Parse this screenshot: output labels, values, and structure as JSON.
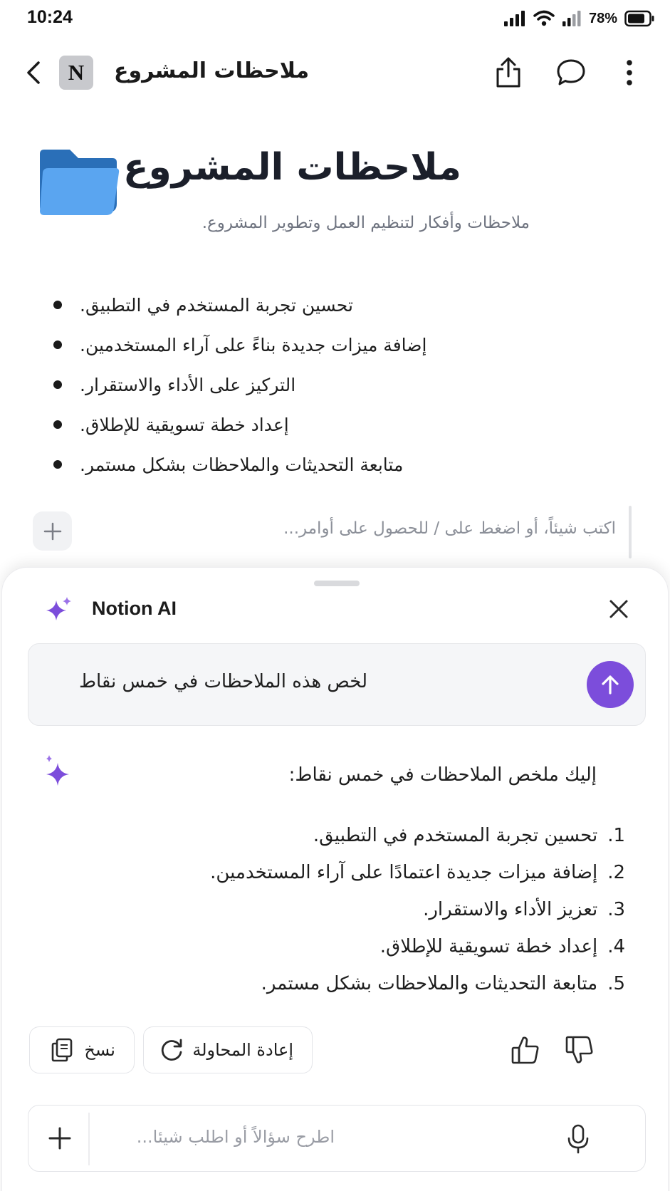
{
  "status_bar": {
    "time": "10:24",
    "battery": "78%",
    "icons": [
      "signal-icon",
      "wifi-icon",
      "secondary-signal-icon",
      "battery-icon"
    ]
  },
  "topnav": {
    "workspace_badge": "N",
    "title": "ملاحظات المشروع",
    "icons": [
      "back-chevron-icon",
      "share-icon",
      "comment-icon",
      "more-vertical-icon"
    ]
  },
  "page": {
    "icon": "folder-icon",
    "title": "ملاحظات المشروع",
    "description": "ملاحظات وأفكار لتنظيم العمل وتطوير المشروع.",
    "bullets": [
      "تحسين تجربة المستخدم في التطبيق.",
      "إضافة ميزات جديدة بناءً على آراء المستخدمين.",
      "التركيز على الأداء والاستقرار.",
      "إعداد خطة تسويقية للإطلاق.",
      "متابعة التحديثات والملاحظات بشكل مستمر."
    ],
    "editor_placeholder": "اكتب شيئاً، أو اضغط على / للحصول على أوامر..."
  },
  "ai_panel": {
    "title": "Notion AI",
    "prompt": "لخص هذه الملاحظات في خمس نقاط",
    "response_intro": "إليك ملخص الملاحظات في خمس نقاط:",
    "response_items": [
      {
        "num": "1.",
        "text": "تحسين تجربة المستخدم في التطبيق."
      },
      {
        "num": "2.",
        "text": "إضافة ميزات جديدة اعتمادًا على آراء المستخدمين."
      },
      {
        "num": "3.",
        "text": "تعزيز الأداء والاستقرار."
      },
      {
        "num": "4.",
        "text": "إعداد خطة تسويقية للإطلاق."
      },
      {
        "num": "5.",
        "text": "متابعة التحديثات والملاحظات بشكل مستمر."
      }
    ],
    "copy_label": "نسخ",
    "retry_label": "إعادة المحاولة",
    "ask_placeholder": "اطرح سؤالاً أو اطلب شيئا...",
    "accent_color": "#7c4ddb"
  }
}
